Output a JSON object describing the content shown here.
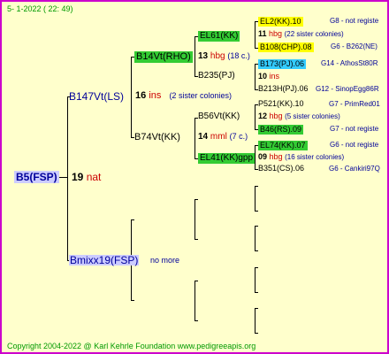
{
  "header": "5-   1-2022  ( 22:  49)",
  "footer": "Copyright 2004-2022 @ Karl Kehrle Foundation    www.pedigreeapis.org",
  "colors": {
    "border": "#cc00cc",
    "bg": "#ffffcc",
    "green": "#33cc33",
    "yellow": "#ffff00",
    "cyan": "#33ccff",
    "blue": "#000099",
    "red": "#cc0000",
    "green_text": "#009900"
  },
  "g0": {
    "code": "B5(FSP)",
    "num": "19",
    "desc": "nat"
  },
  "g1": [
    {
      "code": "B147Vt(LS)",
      "num": "16",
      "desc": "ins",
      "note": "(2 sister colonies)"
    },
    {
      "code": "Bmixx19(FSP)",
      "note": "no more"
    }
  ],
  "g2": [
    {
      "code": "B14Vt(RHO)",
      "num": "13",
      "desc": "hbg",
      "note": "(18 c.)"
    },
    {
      "code": "B74Vt(KK)",
      "num": "14",
      "desc": "mml",
      "note": "(7 c.)"
    }
  ],
  "g3": [
    {
      "code": "EL61(KK)"
    },
    {
      "code": "B235(PJ)"
    },
    {
      "code": "B56Vt(KK)"
    },
    {
      "code": "EL41(KK)gpp"
    }
  ],
  "g4": [
    {
      "code": "EL2(KK).10",
      "ref": "G8 - not registe"
    },
    {
      "num": "11",
      "desc": "hbg",
      "note": "(22 sister colonies)"
    },
    {
      "code": "B108(CHP).08",
      "ref": "G6 - B262(NE)"
    },
    {
      "code": "B173(PJ).06",
      "ref": "G14 - AthosSt80R"
    },
    {
      "num": "10",
      "desc": "ins"
    },
    {
      "code": "B213H(PJ).06",
      "ref": "G12 - SinopEgg86R"
    },
    {
      "code": "P521(KK).10",
      "ref": "G7 - PrimRed01"
    },
    {
      "num": "12",
      "desc": "hbg",
      "note": "(5 sister colonies)"
    },
    {
      "code": "B46(RS).09",
      "ref": "G7 - not registe"
    },
    {
      "code": "EL74(KK).07",
      "ref": "G6 - not registe"
    },
    {
      "num": "09",
      "desc": "hbg",
      "note": "(16 sister colonies)"
    },
    {
      "code": "B351(CS).06",
      "ref": "G6 - Cankiri97Q"
    }
  ]
}
